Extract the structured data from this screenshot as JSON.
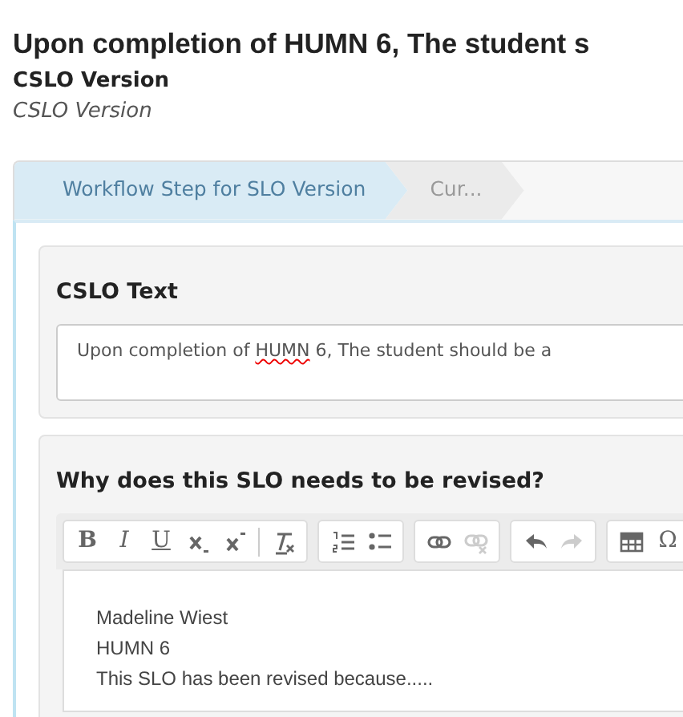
{
  "title": "Upon completion of HUMN 6, The student s",
  "subtitle": "CSLO Version",
  "subtitle_italic": "CSLO Version",
  "steps": [
    {
      "label": "Workflow Step for SLO Version",
      "selected": true
    },
    {
      "label": "Cur...",
      "selected": false
    }
  ],
  "cslo_text": {
    "label": "CSLO Text",
    "value": [
      {
        "text": "Upon completion of ",
        "misspelled": false
      },
      {
        "text": "HUMN",
        "misspelled": true
      },
      {
        "text": " 6, The student should be a",
        "misspelled": false
      }
    ]
  },
  "revision": {
    "label": "Why does this SLO needs to be revised?",
    "toolbar": [
      [
        {
          "kind": "bold",
          "label": "B",
          "disabled": false
        },
        {
          "kind": "italic",
          "label": "I",
          "disabled": false
        },
        {
          "kind": "underline",
          "label": "U",
          "disabled": false
        },
        {
          "kind": "subscript",
          "disabled": false
        },
        {
          "kind": "superscript",
          "disabled": false
        },
        {
          "kind": "separator"
        },
        {
          "kind": "clear-format",
          "disabled": false
        }
      ],
      [
        {
          "kind": "numbered-list",
          "disabled": false
        },
        {
          "kind": "bulleted-list",
          "disabled": false
        }
      ],
      [
        {
          "kind": "link",
          "disabled": false
        },
        {
          "kind": "unlink",
          "disabled": true
        }
      ],
      [
        {
          "kind": "undo",
          "disabled": false
        },
        {
          "kind": "redo",
          "disabled": true
        }
      ],
      [
        {
          "kind": "table",
          "disabled": false
        },
        {
          "kind": "special-char",
          "label": "Ω",
          "disabled": false
        }
      ]
    ],
    "lines": [
      "Madeline Wiest",
      "HUMN 6",
      "This SLO has been revised because....."
    ]
  }
}
